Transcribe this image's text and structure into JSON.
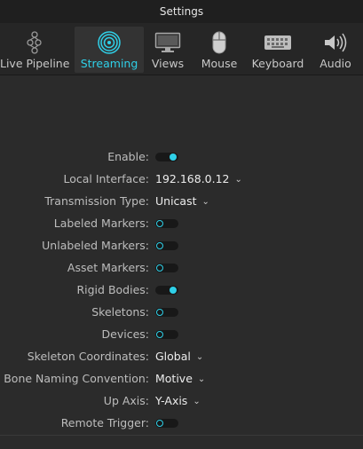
{
  "window": {
    "title": "Settings"
  },
  "tabs": [
    {
      "label": "Live Pipeline",
      "icon": "pipeline-icon",
      "active": false
    },
    {
      "label": "Streaming",
      "icon": "streaming-icon",
      "active": true
    },
    {
      "label": "Views",
      "icon": "monitor-icon",
      "active": false
    },
    {
      "label": "Mouse",
      "icon": "mouse-icon",
      "active": false
    },
    {
      "label": "Keyboard",
      "icon": "keyboard-icon",
      "active": false
    },
    {
      "label": "Audio",
      "icon": "speaker-icon",
      "active": false
    }
  ],
  "settings": {
    "enable": {
      "label": "Enable:",
      "on": true
    },
    "local_interface": {
      "label": "Local Interface:",
      "value": "192.168.0.12"
    },
    "transmission_type": {
      "label": "Transmission Type:",
      "value": "Unicast"
    },
    "labeled_markers": {
      "label": "Labeled Markers:",
      "on": false
    },
    "unlabeled_markers": {
      "label": "Unlabeled Markers:",
      "on": false
    },
    "asset_markers": {
      "label": "Asset Markers:",
      "on": false
    },
    "rigid_bodies": {
      "label": "Rigid Bodies:",
      "on": true
    },
    "skeletons": {
      "label": "Skeletons:",
      "on": false
    },
    "devices": {
      "label": "Devices:",
      "on": false
    },
    "skeleton_coordinates": {
      "label": "Skeleton Coordinates:",
      "value": "Global"
    },
    "bone_naming_convention": {
      "label": "Bone Naming Convention:",
      "value": "Motive"
    },
    "up_axis": {
      "label": "Up Axis:",
      "value": "Y-Axis"
    },
    "remote_trigger": {
      "label": "Remote Trigger:",
      "on": false
    }
  },
  "colors": {
    "accent": "#2fd0e8",
    "background": "#2b2b2b",
    "tabbar": "#262626"
  }
}
